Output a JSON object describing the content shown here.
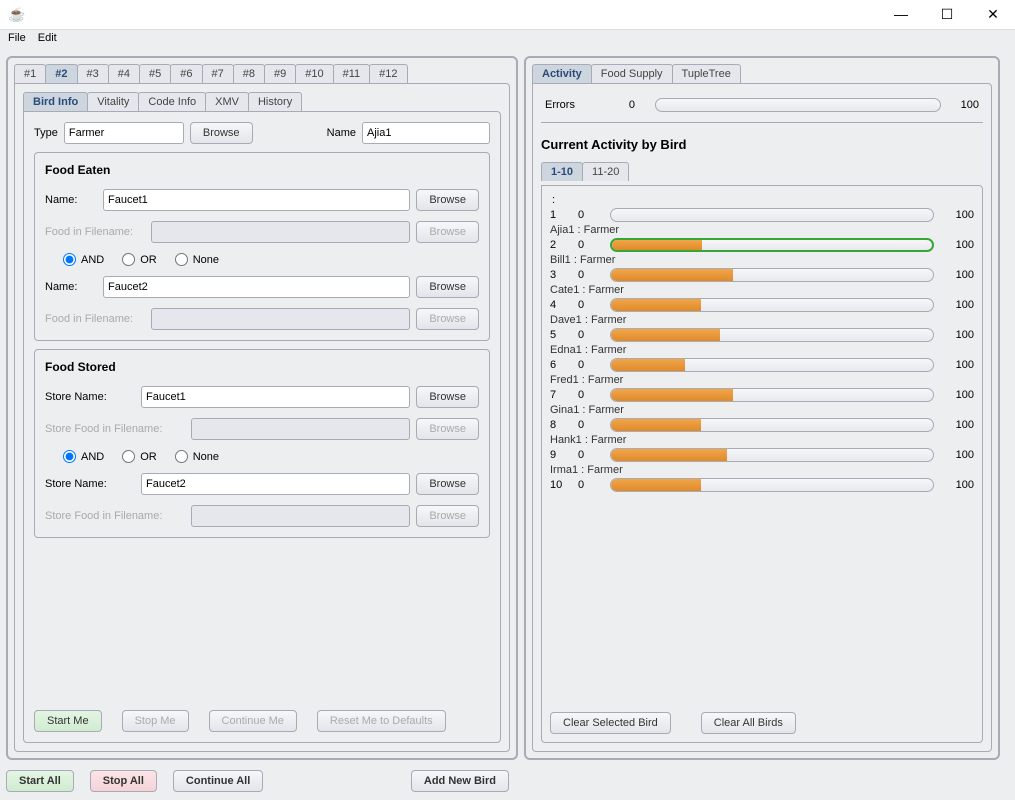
{
  "titlebar": {
    "icon": "☕"
  },
  "menu": {
    "file": "File",
    "edit": "Edit"
  },
  "numTabs": [
    "#1",
    "#2",
    "#3",
    "#4",
    "#5",
    "#6",
    "#7",
    "#8",
    "#9",
    "#10",
    "#11",
    "#12"
  ],
  "numTabActive": 1,
  "infoTabs": [
    "Bird Info",
    "Vitality",
    "Code Info",
    "XMV",
    "History"
  ],
  "infoTabActive": 0,
  "typeRow": {
    "typeLabel": "Type",
    "typeVal": "Farmer",
    "browse": "Browse",
    "nameLabel": "Name",
    "nameVal": "Ajia1"
  },
  "foodEaten": {
    "title": "Food Eaten",
    "nameLabel": "Name:",
    "fileLabel": "Food in Filename:",
    "browse": "Browse",
    "radios": {
      "and": "AND",
      "or": "OR",
      "none": "None",
      "sel": "and"
    },
    "item1": "Faucet1",
    "item2": "Faucet2"
  },
  "foodStored": {
    "title": "Food Stored",
    "nameLabel": "Store Name:",
    "fileLabel": "Store Food in Filename:",
    "browse": "Browse",
    "radios": {
      "and": "AND",
      "or": "OR",
      "none": "None",
      "sel": "and"
    },
    "item1": "Faucet1",
    "item2": "Faucet2"
  },
  "ctrlBtns": {
    "start": "Start Me",
    "stop": "Stop Me",
    "cont": "Continue Me",
    "reset": "Reset Me to Defaults"
  },
  "globalBtns": {
    "start": "Start All",
    "stop": "Stop All",
    "cont": "Continue All",
    "add": "Add New Bird"
  },
  "rightTabs": [
    "Activity",
    "Food Supply",
    "TupleTree"
  ],
  "rightTabActive": 0,
  "errors": {
    "label": "Errors",
    "lo": "0",
    "hi": "100",
    "val": 0
  },
  "activity": {
    "title": "Current Activity by Bird",
    "ranges": [
      "1-10",
      "11-20"
    ],
    "rangeActive": 0,
    "topColon": ":",
    "items": [
      {
        "idx": 1,
        "label": "",
        "lo": "0",
        "hi": "100",
        "pct": 0,
        "highlight": false
      },
      {
        "idx": 2,
        "label": "Ajia1 : Farmer",
        "lo": "0",
        "hi": "100",
        "pct": 28,
        "highlight": true
      },
      {
        "idx": 3,
        "label": "Bill1 : Farmer",
        "lo": "0",
        "hi": "100",
        "pct": 38,
        "highlight": false
      },
      {
        "idx": 4,
        "label": "Cate1 : Farmer",
        "lo": "0",
        "hi": "100",
        "pct": 28,
        "highlight": false
      },
      {
        "idx": 5,
        "label": "Dave1 : Farmer",
        "lo": "0",
        "hi": "100",
        "pct": 34,
        "highlight": false
      },
      {
        "idx": 6,
        "label": "Edna1 : Farmer",
        "lo": "0",
        "hi": "100",
        "pct": 23,
        "highlight": false
      },
      {
        "idx": 7,
        "label": "Fred1 : Farmer",
        "lo": "0",
        "hi": "100",
        "pct": 38,
        "highlight": false
      },
      {
        "idx": 8,
        "label": "Gina1 : Farmer",
        "lo": "0",
        "hi": "100",
        "pct": 28,
        "highlight": false
      },
      {
        "idx": 9,
        "label": "Hank1 : Farmer",
        "lo": "0",
        "hi": "100",
        "pct": 36,
        "highlight": false
      },
      {
        "idx": 10,
        "label": "Irma1 : Farmer",
        "lo": "0",
        "hi": "100",
        "pct": 28,
        "highlight": false
      }
    ],
    "clearBtns": {
      "sel": "Clear Selected Bird",
      "all": "Clear All Birds"
    }
  }
}
